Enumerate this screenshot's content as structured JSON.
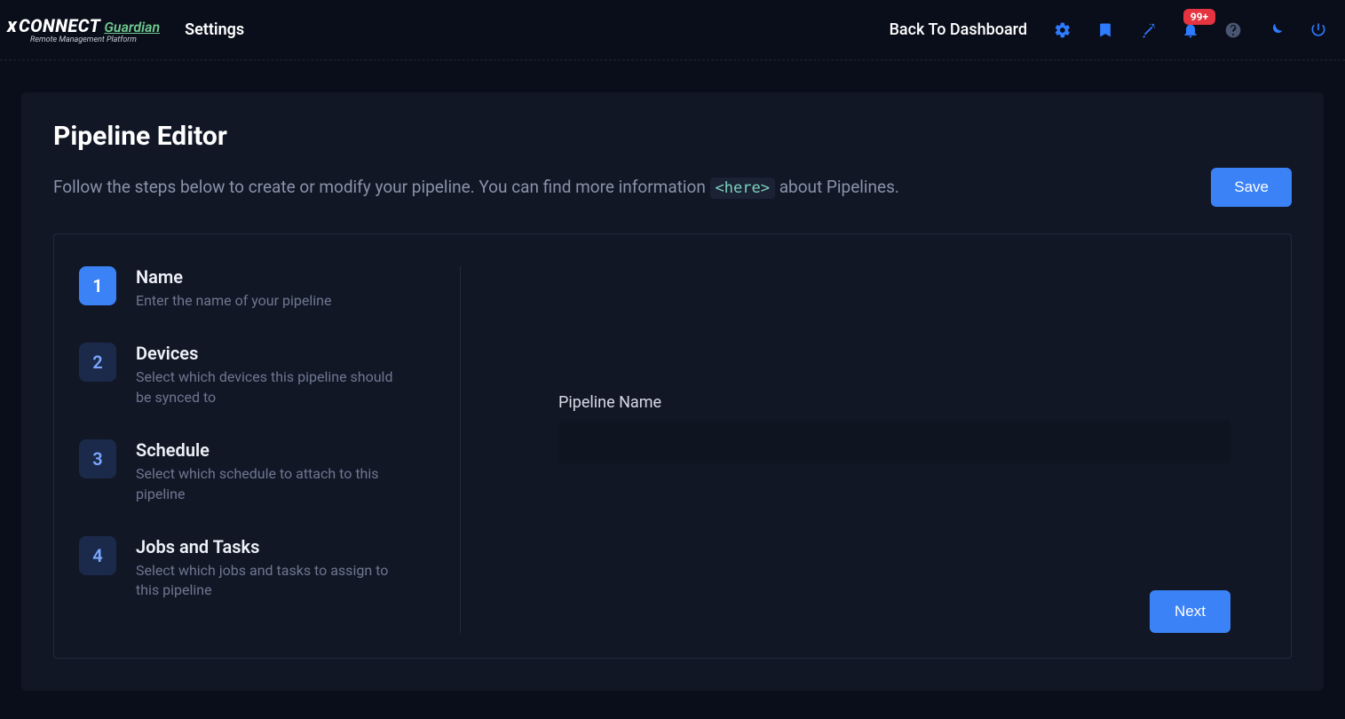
{
  "header": {
    "logo": {
      "x": "x",
      "connect": "CONNECT",
      "guardian": "Guardian",
      "sub": "Remote Management Platform"
    },
    "title": "Settings",
    "back": "Back To Dashboard",
    "badge": "99+"
  },
  "page": {
    "title": "Pipeline Editor",
    "subtitle_pre": "Follow the steps below to create or modify your pipeline. You can find more information ",
    "here": "<here>",
    "subtitle_post": " about Pipelines.",
    "save": "Save",
    "next": "Next"
  },
  "steps": [
    {
      "num": "1",
      "title": "Name",
      "desc": "Enter the name of your pipeline",
      "active": true
    },
    {
      "num": "2",
      "title": "Devices",
      "desc": "Select which devices this pipeline should be synced to",
      "active": false
    },
    {
      "num": "3",
      "title": "Schedule",
      "desc": "Select which schedule to attach to this pipeline",
      "active": false
    },
    {
      "num": "4",
      "title": "Jobs and Tasks",
      "desc": "Select which jobs and tasks to assign to this pipeline",
      "active": false
    }
  ],
  "form": {
    "name_label": "Pipeline Name",
    "name_value": ""
  }
}
